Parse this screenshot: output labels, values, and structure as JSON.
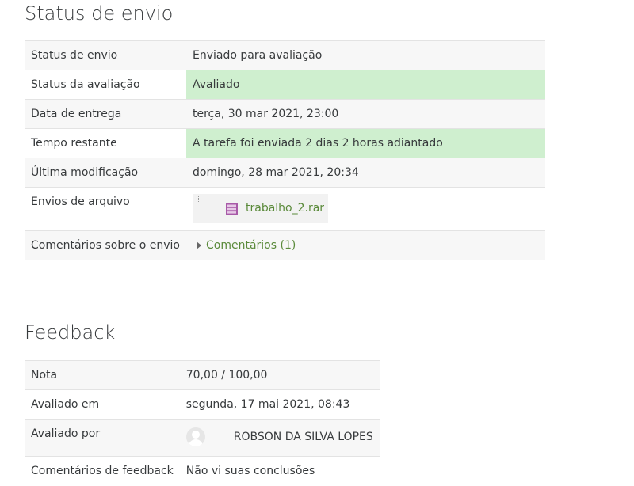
{
  "submission": {
    "heading": "Status de envio",
    "rows": [
      {
        "label": "Status de envio",
        "value": "Enviado para avaliação"
      },
      {
        "label": "Status da avaliação",
        "value": "Avaliado"
      },
      {
        "label": "Data de entrega",
        "value": "terça, 30 mar 2021, 23:00"
      },
      {
        "label": "Tempo restante",
        "value": "A tarefa foi enviada 2 dias 2 horas adiantado"
      },
      {
        "label": "Última modificação",
        "value": "domingo, 28 mar 2021, 20:34"
      },
      {
        "label": "Envios de arquivo",
        "file": "trabalho_2.rar"
      },
      {
        "label": "Comentários sobre o envio",
        "comments_link": "Comentários (1)"
      }
    ]
  },
  "feedback": {
    "heading": "Feedback",
    "rows": [
      {
        "label": "Nota",
        "value": "70,00 / 100,00"
      },
      {
        "label": "Avaliado em",
        "value": "segunda, 17 mai 2021, 08:43"
      },
      {
        "label": "Avaliado por",
        "value": "ROBSON DA SILVA LOPES"
      },
      {
        "label": "Comentários de feedback",
        "value": "Não vi suas conclusões"
      }
    ]
  },
  "colors": {
    "success_bg": "#cfefcf",
    "link": "#5a8a3a",
    "row_alt": "#f7f7f7"
  },
  "icons": {
    "file_type": "archive-rar-icon",
    "expand": "triangle-right-icon",
    "user": "user-avatar-icon"
  }
}
